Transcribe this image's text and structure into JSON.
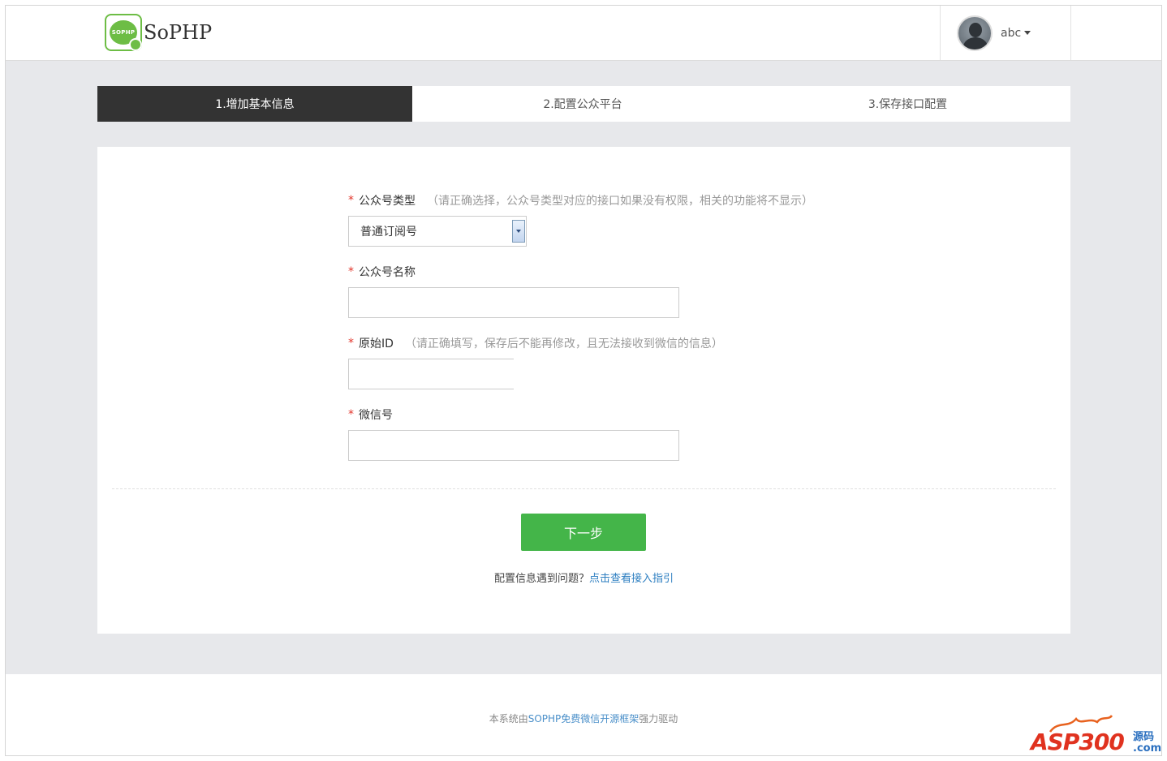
{
  "header": {
    "logo_badge_text": "SOPHP",
    "logo_text": "SoPHP",
    "username": "abc"
  },
  "steps": [
    {
      "label": "1.增加基本信息",
      "active": true
    },
    {
      "label": "2.配置公众平台",
      "active": false
    },
    {
      "label": "3.保存接口配置",
      "active": false
    }
  ],
  "form": {
    "required_mark": "*",
    "account_type": {
      "label": "公众号类型",
      "hint": "（请正确选择，公众号类型对应的接口如果没有权限，相关的功能将不显示）",
      "selected": "普通订阅号"
    },
    "account_name": {
      "label": "公众号名称",
      "value": ""
    },
    "original_id": {
      "label": "原始ID",
      "hint": "（请正确填写，保存后不能再修改，且无法接收到微信的信息）",
      "value": ""
    },
    "wechat_id": {
      "label": "微信号",
      "value": ""
    },
    "next_button": "下一步",
    "help_text": "配置信息遇到问题？",
    "help_link": "点击查看接入指引"
  },
  "footer": {
    "prefix": "本系统由",
    "link": "SOPHP免费微信开源框架",
    "suffix": "强力驱动"
  },
  "watermark": {
    "main": "ASP300",
    "sub_top": "源码",
    "sub_bottom": ".com"
  },
  "colors": {
    "accent_green": "#44b549",
    "step_active_bg": "#333333",
    "required_red": "#e2352b",
    "link_blue": "#2e7fc1",
    "page_gray": "#e7e8eb"
  }
}
